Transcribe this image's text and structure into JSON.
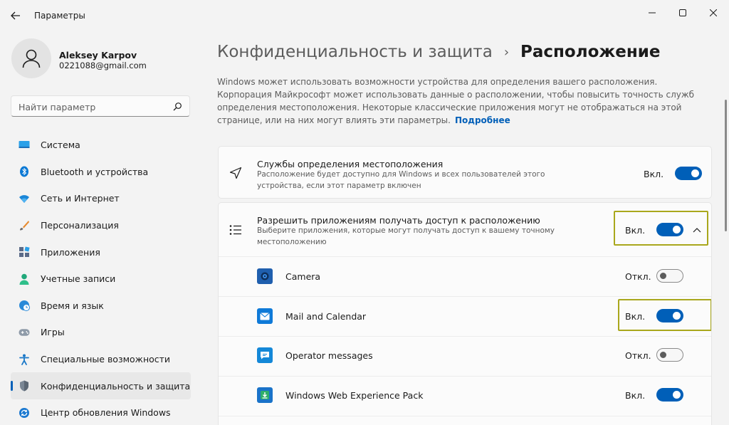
{
  "window": {
    "title": "Параметры"
  },
  "profile": {
    "name": "Aleksey Karpov",
    "email": "0221088@gmail.com"
  },
  "search": {
    "placeholder": "Найти параметр"
  },
  "sidebar": {
    "items": [
      {
        "label": "Система",
        "icon": "system-icon",
        "active": false
      },
      {
        "label": "Bluetooth и устройства",
        "icon": "bluetooth-icon",
        "active": false
      },
      {
        "label": "Сеть и Интернет",
        "icon": "wifi-icon",
        "active": false
      },
      {
        "label": "Персонализация",
        "icon": "brush-icon",
        "active": false
      },
      {
        "label": "Приложения",
        "icon": "apps-icon",
        "active": false
      },
      {
        "label": "Учетные записи",
        "icon": "account-icon",
        "active": false
      },
      {
        "label": "Время и язык",
        "icon": "globe-clock-icon",
        "active": false
      },
      {
        "label": "Игры",
        "icon": "gamepad-icon",
        "active": false
      },
      {
        "label": "Специальные возможности",
        "icon": "accessibility-icon",
        "active": false
      },
      {
        "label": "Конфиденциальность и защита",
        "icon": "shield-icon",
        "active": true
      },
      {
        "label": "Центр обновления Windows",
        "icon": "update-icon",
        "active": false
      }
    ]
  },
  "breadcrumb": {
    "parent": "Конфиденциальность и защита",
    "separator": "›",
    "current": "Расположение"
  },
  "description": {
    "text": "Windows может использовать возможности устройства для определения вашего расположения. Корпорация Майкрософт может использовать данные о расположении, чтобы повысить точность служб определения местоположения. Некоторые классические приложения могут не отображаться на этой странице, или на них могут влиять эти параметры.",
    "link": "Подробнее"
  },
  "location_services": {
    "title": "Службы определения местоположения",
    "subtitle": "Расположение будет доступно для Windows и всех пользователей этого устройства, если этот параметр включен",
    "state": "Вкл.",
    "on": true
  },
  "app_access": {
    "title": "Разрешить приложениям получать доступ к расположению",
    "subtitle": "Выберите приложения, которые могут получать доступ к вашему точному местоположению",
    "state": "Вкл.",
    "on": true,
    "apps": [
      {
        "name": "Camera",
        "state": "Откл.",
        "on": false,
        "icon": "camera-app-icon",
        "color": "#1f5fae"
      },
      {
        "name": "Mail and Calendar",
        "state": "Вкл.",
        "on": true,
        "icon": "mail-app-icon",
        "color": "#0f7ad8"
      },
      {
        "name": "Operator messages",
        "state": "Откл.",
        "on": false,
        "icon": "message-app-icon",
        "color": "#1488d8"
      },
      {
        "name": "Windows Web Experience Pack",
        "state": "Вкл.",
        "on": true,
        "icon": "widgets-app-icon",
        "color": "#1a73c9"
      }
    ]
  },
  "colors": {
    "accent": "#005fb8",
    "highlight": "#a9a71c"
  }
}
